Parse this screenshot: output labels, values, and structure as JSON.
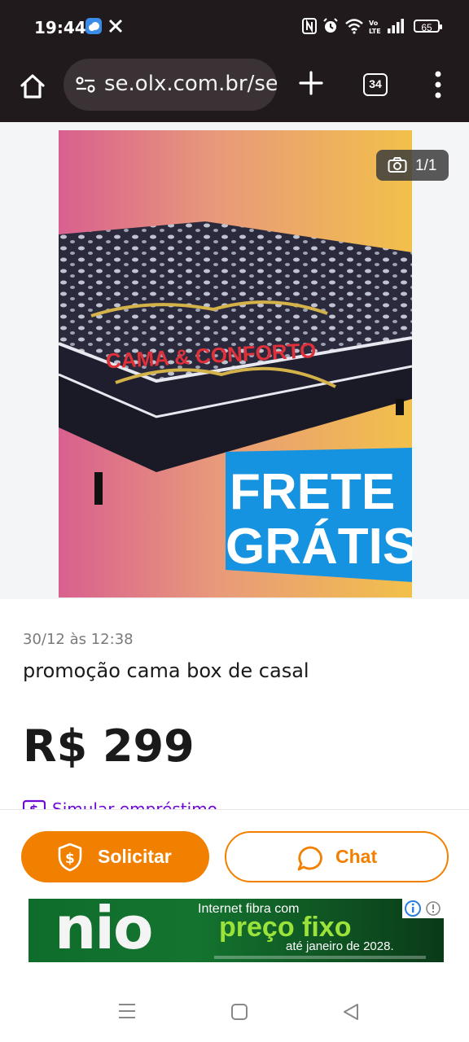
{
  "status_bar": {
    "time": "19:44",
    "icons": [
      "weather-icon",
      "x-icon",
      "nfc-icon",
      "alarm-icon",
      "wifi-icon",
      "volte-icon",
      "signal-icon"
    ],
    "battery": "65"
  },
  "browser": {
    "url": "se.olx.com.br/ser",
    "tab_count": "34"
  },
  "listing": {
    "photo_counter": "1/1",
    "image_overlay": "FRETE GRÁTIS",
    "image_brand_text": "CAMA & CONFORTO",
    "date": "30/12 às 12:38",
    "title": "promoção cama box de casal",
    "price": "R$ 299",
    "loan_link": "Simular empréstimo"
  },
  "actions": {
    "solicitar_label": "Solicitar",
    "chat_label": "Chat"
  },
  "ad": {
    "logo": "nio",
    "line1": "Internet fibra com",
    "line2": "preço fixo",
    "line3": "até janeiro de 2028."
  },
  "colors": {
    "accent": "#f28000",
    "link": "#6e0ad6",
    "chrome_bg": "#211a1d"
  }
}
